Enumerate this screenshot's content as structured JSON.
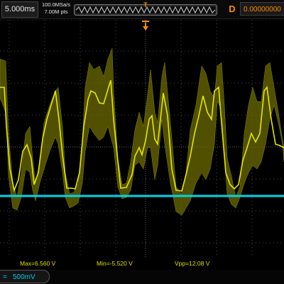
{
  "header": {
    "timebase": "5.000ms",
    "sample_rate": "100.0MSa/s",
    "memory_depth": "7.00M pts",
    "trigger_marker": "T",
    "trigger_mode": "D",
    "trigger_time": "0.00000000"
  },
  "measurements": {
    "max": "Max=6.560 V",
    "min": "Min=-5.520 V",
    "vpp": "Vpp=12.08 V"
  },
  "channel": {
    "coupling": "=",
    "scale": "500mV"
  },
  "colors": {
    "ch1_trace": "#e6e600",
    "ch2_trace": "#00d4e6",
    "trigger": "#ff8c00",
    "grid": "#555555"
  }
}
